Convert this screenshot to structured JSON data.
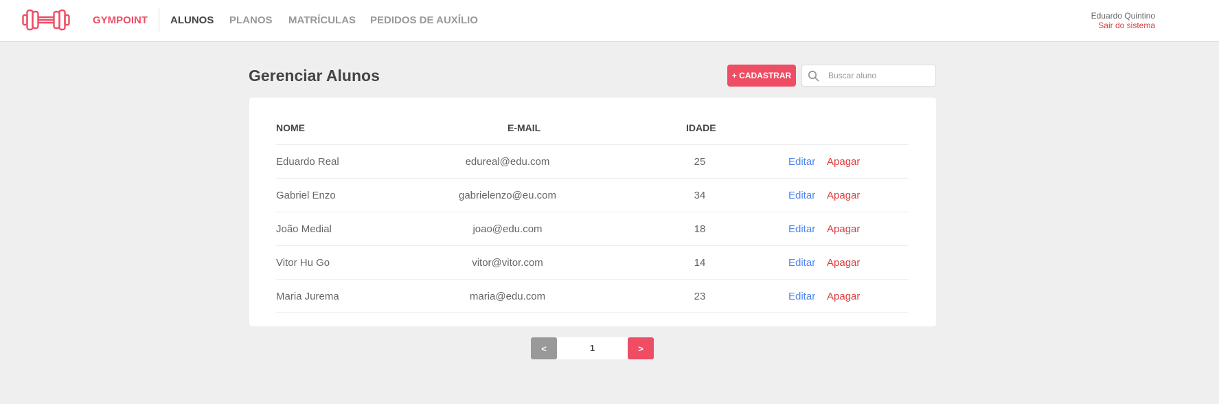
{
  "header": {
    "brand": "GYMPOINT",
    "logo_icon": "dumbbell-icon",
    "brand_color": "#ee4d64",
    "nav": [
      {
        "label": "ALUNOS",
        "active": true
      },
      {
        "label": "PLANOS",
        "active": false
      },
      {
        "label": "MATRÍCULAS",
        "active": false
      },
      {
        "label": "PEDIDOS DE AUXÍLIO",
        "active": false
      }
    ],
    "user_name": "Eduardo Quintino",
    "logout_label": "Sair do sistema"
  },
  "page": {
    "title": "Gerenciar Alunos",
    "add_button_label": "+ CADASTRAR",
    "search_placeholder": "Buscar aluno",
    "search_icon": "search-icon"
  },
  "table": {
    "columns": [
      "NOME",
      "E-MAIL",
      "IDADE"
    ],
    "rows": [
      {
        "name": "Eduardo Real",
        "email": "edureal@edu.com",
        "age": "25",
        "edit": "Editar",
        "delete": "Apagar"
      },
      {
        "name": "Gabriel Enzo",
        "email": "gabrielenzo@eu.com",
        "age": "34",
        "edit": "Editar",
        "delete": "Apagar"
      },
      {
        "name": "João Medial",
        "email": "joao@edu.com",
        "age": "18",
        "edit": "Editar",
        "delete": "Apagar"
      },
      {
        "name": "Vitor Hu Go",
        "email": "vitor@vitor.com",
        "age": "14",
        "edit": "Editar",
        "delete": "Apagar"
      },
      {
        "name": "Maria Jurema",
        "email": "maria@edu.com",
        "age": "23",
        "edit": "Editar",
        "delete": "Apagar"
      }
    ]
  },
  "pagination": {
    "prev_label": "<",
    "current_page": "1",
    "next_label": ">"
  },
  "colors": {
    "primary": "#ee4d64",
    "link_edit": "#4d85ee",
    "link_delete": "#de3b3b",
    "background": "#efefef"
  }
}
